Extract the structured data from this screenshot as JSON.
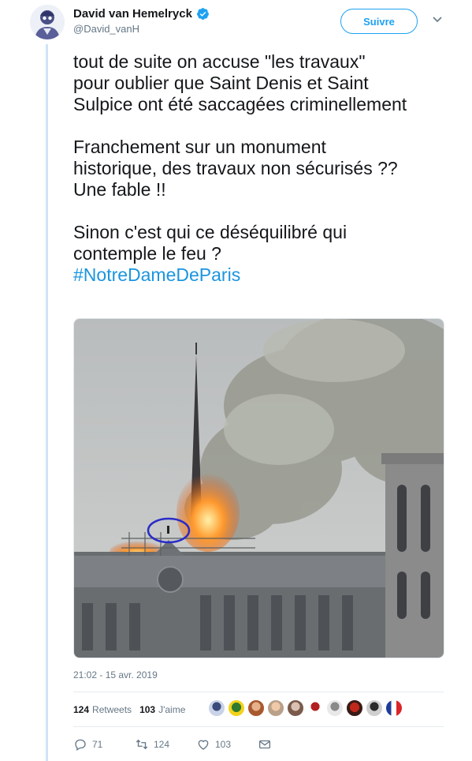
{
  "tweet": {
    "author": {
      "display_name": "David van Hemelryck",
      "handle": "@David_vanH",
      "verified": true
    },
    "follow_label": "Suivre",
    "text_lines": [
      "tout de suite on accuse \"les travaux\"",
      "pour oublier que Saint Denis et Saint",
      "Sulpice ont été saccagées criminellement",
      "Franchement sur un monument",
      "historique, des travaux non sécurisés ??",
      "Une fable !!",
      "Sinon c'est qui ce déséquilibré qui",
      "contemple le feu ?"
    ],
    "hashtag": "#NotreDameDeParis",
    "timestamp": "21:02 - 15 avr. 2019",
    "stats": {
      "retweets_count": "124",
      "retweets_label": "Retweets",
      "likes_count": "103",
      "likes_label": "J'aime"
    },
    "actions": {
      "replies": "71",
      "retweets": "124",
      "likes": "103"
    }
  },
  "colors": {
    "accent": "#1da1f2",
    "hashtag": "#1b95e0",
    "muted": "#657786",
    "thread_line": "#cfe4f7"
  },
  "icons": [
    "verified-badge-icon",
    "chevron-down-icon",
    "reply-icon",
    "retweet-icon",
    "like-icon",
    "direct-message-icon"
  ]
}
